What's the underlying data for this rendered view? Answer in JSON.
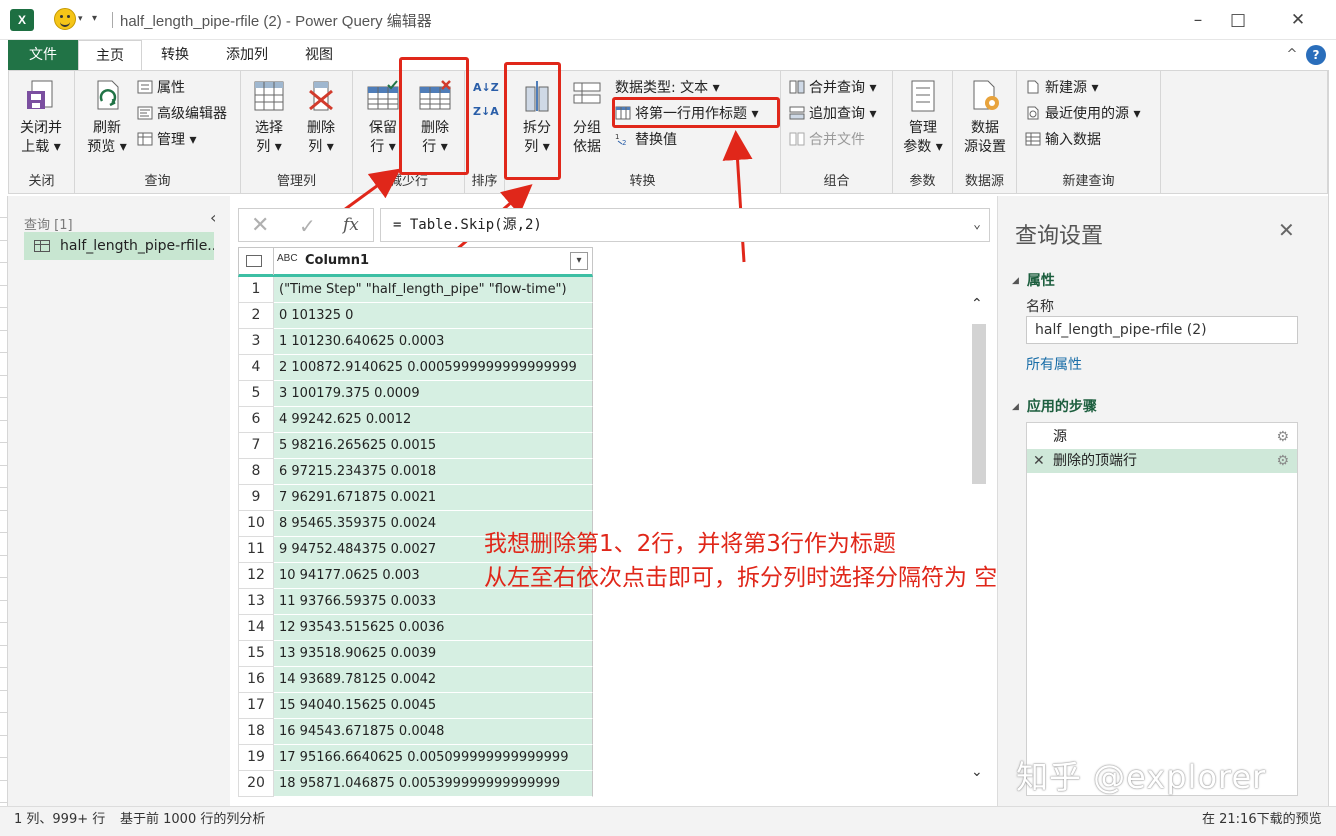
{
  "window": {
    "title": "half_length_pipe-rfile (2) - Power Query 编辑器",
    "app_logo_text": "X"
  },
  "tabs": [
    "文件",
    "主页",
    "转换",
    "添加列",
    "视图"
  ],
  "ribbon": {
    "close_group": {
      "label": "关闭",
      "close_load": [
        "关闭并",
        "上载 ▾"
      ]
    },
    "query_group": {
      "label": "查询",
      "refresh": [
        "刷新",
        "预览 ▾"
      ],
      "properties": "属性",
      "advanced_editor": "高级编辑器",
      "manage": "管理 ▾"
    },
    "manage_columns_group": {
      "label": "管理列",
      "choose_columns": [
        "选择",
        "列 ▾"
      ],
      "remove_columns": [
        "删除",
        "列 ▾"
      ]
    },
    "reduce_rows_group": {
      "label": "减少行",
      "keep_rows": [
        "保留",
        "行 ▾"
      ],
      "remove_rows": [
        "删除",
        "行 ▾"
      ]
    },
    "sort_group": {
      "label": "排序",
      "sort_asc": "A↓Z",
      "sort_desc": "Z↓A"
    },
    "transform_group": {
      "label": "转换",
      "split_column": [
        "拆分",
        "列 ▾"
      ],
      "group_by": [
        "分组",
        "依据"
      ],
      "data_type": "数据类型: 文本 ▾",
      "use_first_row": "将第一行用作标题 ▾",
      "replace_values": "替换值"
    },
    "combine_group": {
      "label": "组合",
      "merge_queries": "合并查询 ▾",
      "append_queries": "追加查询 ▾",
      "combine_files": "合并文件"
    },
    "params_group": {
      "label": "参数",
      "manage_params": [
        "管理",
        "参数 ▾"
      ]
    },
    "datasource_group": {
      "label": "数据源",
      "datasource_settings": [
        "数据",
        "源设置"
      ]
    },
    "new_query_group": {
      "label": "新建查询",
      "new_source": "新建源 ▾",
      "recent_sources": "最近使用的源 ▾",
      "enter_data": "输入数据"
    }
  },
  "queries_pane": {
    "label": "查询 [1]",
    "item": "half_length_pipe-rfile..."
  },
  "formula": "= Table.Skip(源,2)",
  "grid": {
    "type_label": "ABC",
    "column_name": "Column1",
    "rows": [
      {
        "n": "1",
        "v": "(\"Time Step\" \"half_length_pipe\" \"flow-time\")"
      },
      {
        "n": "2",
        "v": "0 101325 0"
      },
      {
        "n": "3",
        "v": "1 101230.640625 0.0003"
      },
      {
        "n": "4",
        "v": "2 100872.9140625 0.0005999999999999999"
      },
      {
        "n": "5",
        "v": "3 100179.375 0.0009"
      },
      {
        "n": "6",
        "v": "4 99242.625 0.0012"
      },
      {
        "n": "7",
        "v": "5 98216.265625 0.0015"
      },
      {
        "n": "8",
        "v": "6 97215.234375 0.0018"
      },
      {
        "n": "9",
        "v": "7 96291.671875 0.0021"
      },
      {
        "n": "10",
        "v": "8 95465.359375 0.0024"
      },
      {
        "n": "11",
        "v": "9 94752.484375 0.0027"
      },
      {
        "n": "12",
        "v": "10 94177.0625 0.003"
      },
      {
        "n": "13",
        "v": "11 93766.59375 0.0033"
      },
      {
        "n": "14",
        "v": "12 93543.515625 0.0036"
      },
      {
        "n": "15",
        "v": "13 93518.90625 0.0039"
      },
      {
        "n": "16",
        "v": "14 93689.78125 0.0042"
      },
      {
        "n": "17",
        "v": "15 94040.15625 0.0045"
      },
      {
        "n": "18",
        "v": "16 94543.671875 0.0048"
      },
      {
        "n": "19",
        "v": "17 95166.6640625 0.005099999999999999"
      },
      {
        "n": "20",
        "v": "18 95871.046875 0.005399999999999999"
      }
    ]
  },
  "settings": {
    "title": "查询设置",
    "properties_section": "属性",
    "name_label": "名称",
    "name_value": "half_length_pipe-rfile (2)",
    "all_properties": "所有属性",
    "steps_section": "应用的步骤",
    "steps": [
      "源",
      "删除的顶端行"
    ]
  },
  "annotation": {
    "line1": "我想删除第1、2行，并将第3行作为标题",
    "line2": "从左至右依次点击即可，拆分列时选择分隔符为 空格"
  },
  "status": {
    "left": "1 列、999+ 行",
    "profile": "基于前 1000 行的列分析",
    "right": "在 21:16下载的预览"
  },
  "watermark": "知乎 @explorer",
  "colors": {
    "accent": "#217346",
    "annotation": "#e0271a",
    "cell_fill": "#d6efe2"
  }
}
